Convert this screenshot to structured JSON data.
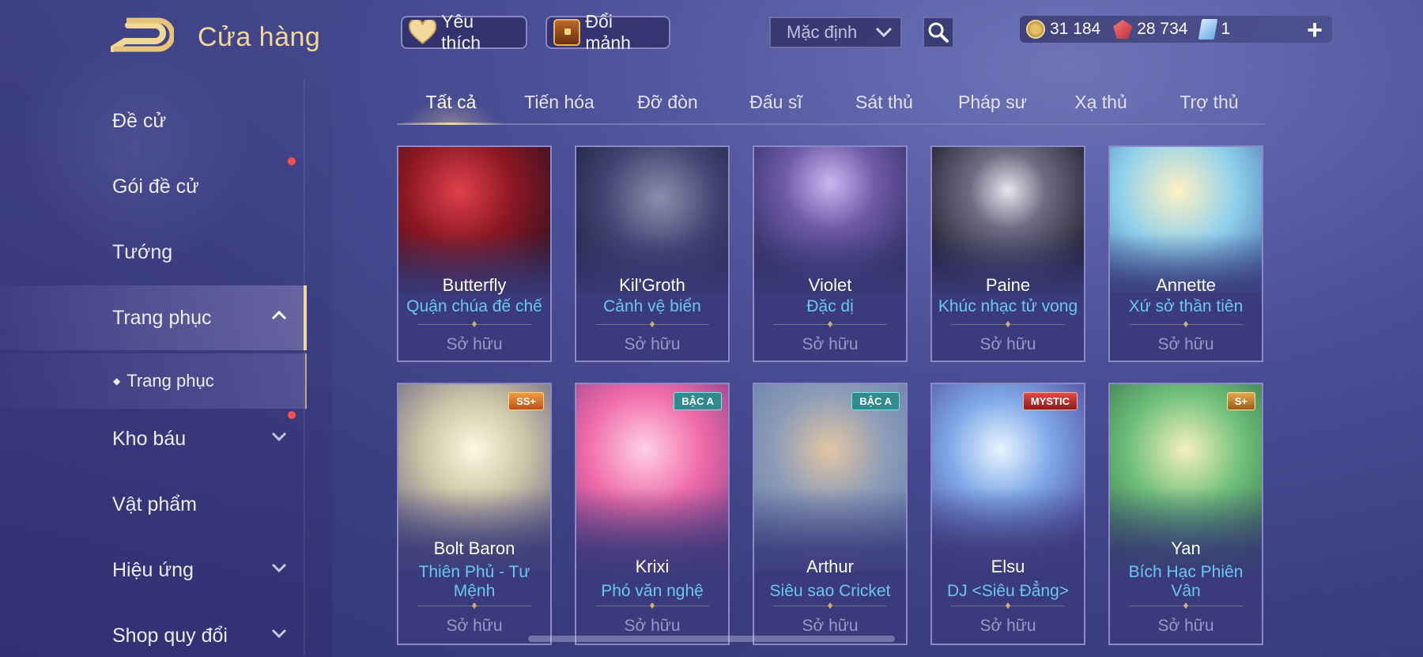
{
  "header": {
    "title": "Cửa hàng",
    "favorites_label": "Yêu thích",
    "shard_label": "Đổi mảnh",
    "sort_value": "Mặc định",
    "currency": {
      "gold": "31 184",
      "gems": "28 734",
      "tickets": "1"
    }
  },
  "sidebar": {
    "items": [
      {
        "label": "Đề cử"
      },
      {
        "label": "Gói đề cử"
      },
      {
        "label": "Tướng"
      },
      {
        "label": "Trang phục"
      },
      {
        "label": "Trang phục"
      },
      {
        "label": "Kho báu"
      },
      {
        "label": "Vật phẩm"
      },
      {
        "label": "Hiệu ứng"
      },
      {
        "label": "Shop quy đổi"
      }
    ]
  },
  "tabs": [
    "Tất cả",
    "Tiến hóa",
    "Đỡ đòn",
    "Đấu sĩ",
    "Sát thủ",
    "Pháp sư",
    "Xạ thủ",
    "Trợ thủ"
  ],
  "cards": [
    {
      "hero": "Butterfly",
      "skin": "Quận chúa đế chế",
      "status": "Sở hữu"
    },
    {
      "hero": "Kil'Groth",
      "skin": "Cảnh vệ biển",
      "status": "Sở hữu"
    },
    {
      "hero": "Violet",
      "skin": "Đặc dị",
      "status": "Sở hữu"
    },
    {
      "hero": "Paine",
      "skin": "Khúc nhạc tử vong",
      "status": "Sở hữu"
    },
    {
      "hero": "Annette",
      "skin": "Xứ sở thần tiên",
      "status": "Sở hữu"
    },
    {
      "hero": "Bolt Baron",
      "skin": "Thiên Phủ - Tư Mệnh",
      "status": "Sở hữu",
      "badge": "SS+"
    },
    {
      "hero": "Krixi",
      "skin": "Phó văn nghệ",
      "status": "Sở hữu",
      "badge": "BẬC A"
    },
    {
      "hero": "Arthur",
      "skin": "Siêu sao Cricket",
      "status": "Sở hữu",
      "badge": "BẬC A"
    },
    {
      "hero": "Elsu",
      "skin": "DJ <Siêu Đẳng>",
      "status": "Sở hữu",
      "badge": "MYSTIC"
    },
    {
      "hero": "Yan",
      "skin": "Bích Hạc Phiên Vân",
      "status": "Sở hữu",
      "badge": "S+"
    }
  ],
  "colors": {
    "accent_gold": "#f0d896",
    "skin_blue": "#69c7f4",
    "notify_red": "#ff4c4c"
  },
  "icons": [
    "back-arrow-icon",
    "heart-icon",
    "chest-icon",
    "chevron-down-icon",
    "search-icon",
    "gold-coin-icon",
    "ruby-gem-icon",
    "ticket-icon",
    "plus-icon",
    "chevron-up-icon"
  ]
}
